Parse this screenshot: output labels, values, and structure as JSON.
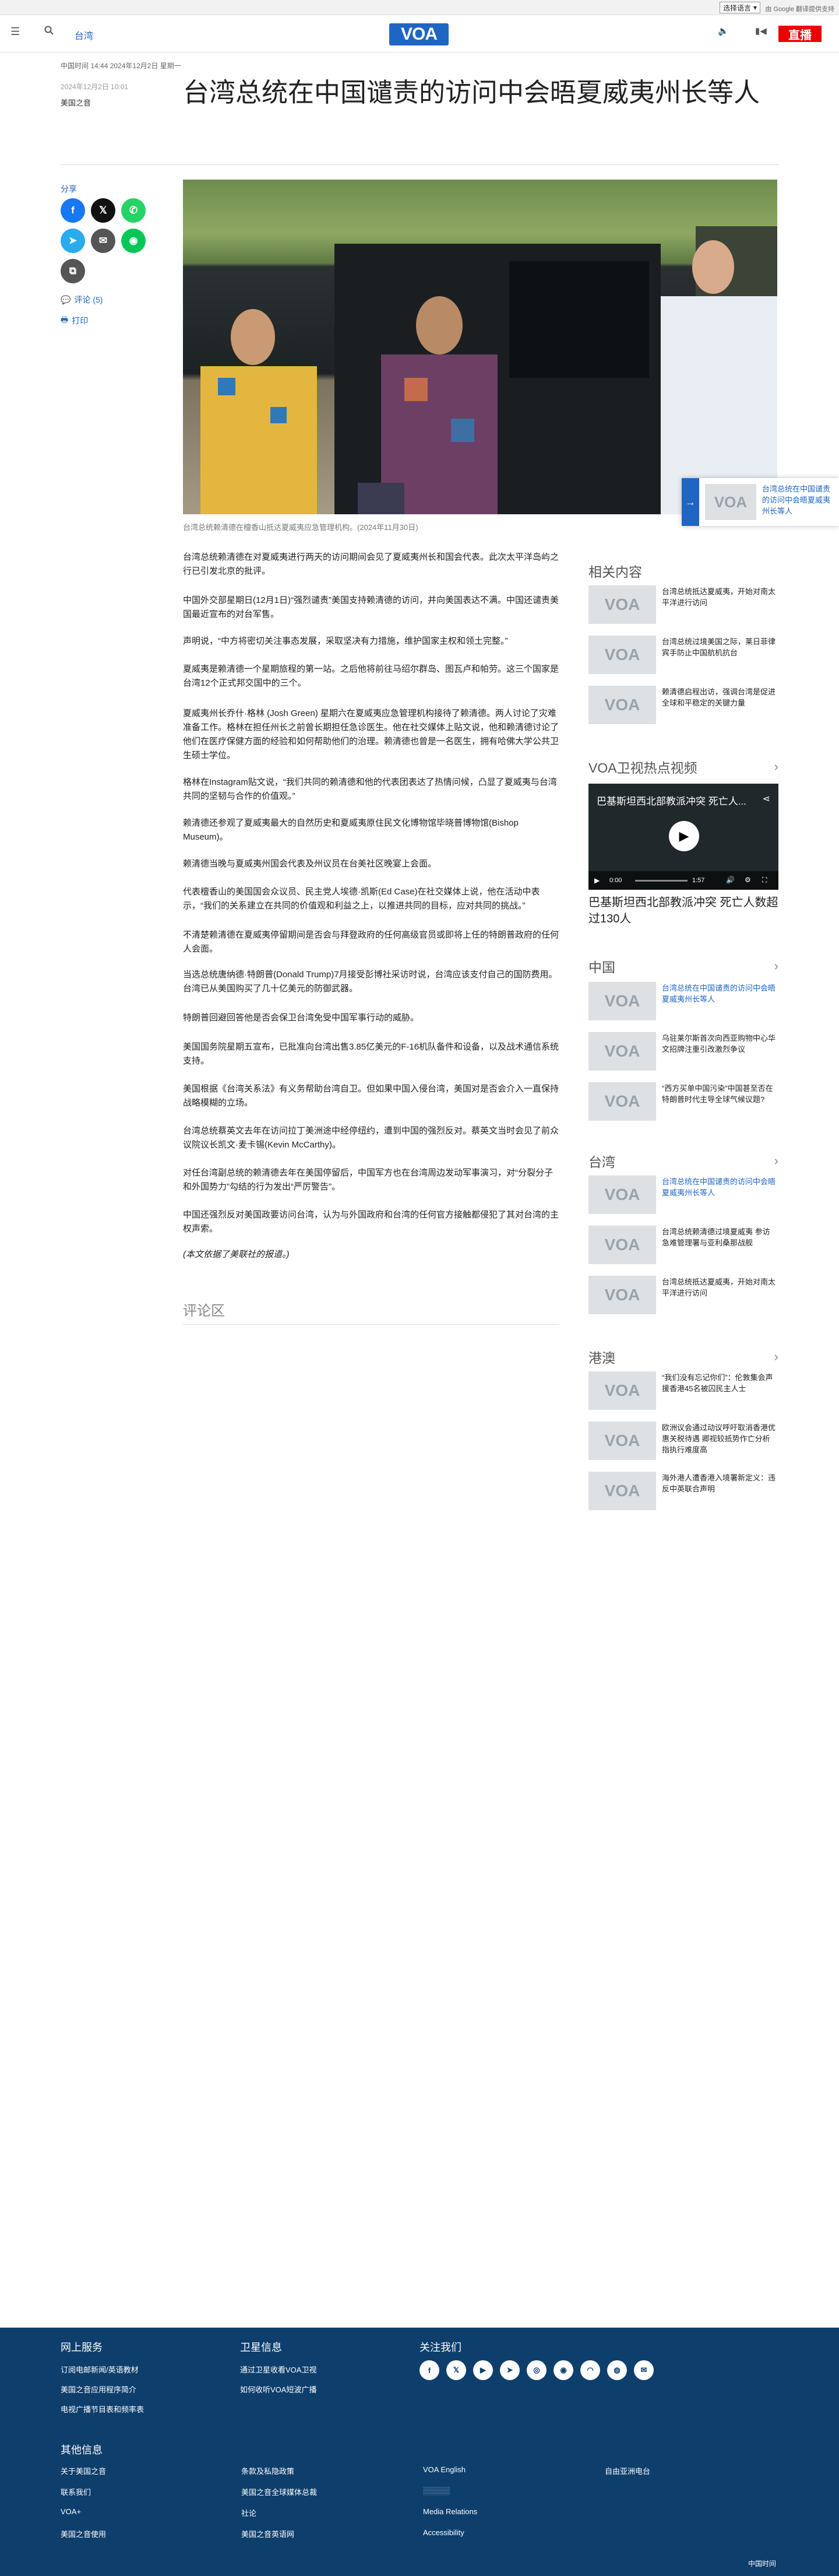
{
  "topbar": {
    "language_select": "选择语言",
    "translate_credit": "由 Google 翻译提供支持"
  },
  "header": {
    "section": "台湾",
    "logo": "VOA",
    "live": "直播",
    "menu_icon": "menu-icon",
    "search_icon": "search-icon"
  },
  "article": {
    "datetime": "中国时间 14:44 2024年12月2日 星期一",
    "published": "2024年12月2日 10:01",
    "author": "美国之音",
    "title": "台湾总统在中国谴责的访问中会晤夏威夷州长等人",
    "share_label": "分享",
    "comments_link": "评论 (5)",
    "print_link": "打印",
    "caption": "台湾总统赖清德在檀香山抵达夏威夷应急管理机构。(2024年11月30日)",
    "paragraphs": [
      "台湾总统赖清德在对夏威夷进行两天的访问期间会见了夏威夷州长和国会代表。此次太平洋岛屿之行已引发北京的批评。",
      "中国外交部星期日(12月1日)“强烈谴责”美国支持赖清德的访问，并向美国表达不满。中国还谴责美国最近宣布的对台军售。",
      "声明说，“中方将密切关注事态发展，采取坚决有力措施，维护国家主权和领土完整。”",
      "夏威夷是赖清德一个星期旅程的第一站。之后他将前往马绍尔群岛、图瓦卢和帕劳。这三个国家是台湾12个正式邦交国中的三个。",
      "夏威夷州长乔什·格林 (Josh Green) 星期六在夏威夷应急管理机构接待了赖清德。两人讨论了灾难准备工作。格林在担任州长之前曾长期担任急诊医生。他在社交媒体上贴文说，他和赖清德讨论了他们在医疗保健方面的经验和如何帮助他们的治理。赖清德也曾是一名医生，拥有哈佛大学公共卫生硕士学位。",
      "格林在Instagram贴文说，“我们共同的赖清德和他的代表团表达了热情问候，凸显了夏威夷与台湾共同的坚韧与合作的价值观。”",
      "赖清德还参观了夏威夷最大的自然历史和夏威夷原住民文化博物馆毕晓普博物馆(Bishop Museum)。",
      "赖清德当晚与夏威夷州国会代表及州议员在台美社区晚宴上会面。",
      "代表檀香山的美国国会众议员、民主党人埃德·凯斯(Ed Case)在社交媒体上说，他在活动中表示，“我们的关系建立在共同的价值观和利益之上，以推进共同的目标，应对共同的挑战。”",
      "不清楚赖清德在夏威夷停留期间是否会与拜登政府的任何高级官员或即将上任的特朗普政府的任何人会面。",
      "当选总统唐纳德·特朗普(Donald Trump)7月接受彭博社采访时说，台湾应该支付自己的国防费用。台湾已从美国购买了几十亿美元的防御武器。",
      "特朗普回避回答他是否会保卫台湾免受中国军事行动的威胁。",
      "美国国务院星期五宣布，已批准向台湾出售3.85亿美元的F-16机队备件和设备，以及战术通信系统支持。",
      "美国根据《台湾关系法》有义务帮助台湾自卫。但如果中国入侵台湾，美国对是否会介入一直保持战略模糊的立场。",
      "台湾总统蔡英文去年在访问拉丁美洲途中经停纽约，遭到中国的强烈反对。蔡英文当时会见了前众议院议长凯文·麦卡锡(Kevin McCarthy)。",
      "对任台湾副总统的赖清德去年在美国停留后，中国军方也在台湾周边发动军事演习，对“分裂分子和外国势力”勾结的行为发出“严厉警告”。",
      "中国还强烈反对美国政要访问台湾，认为与外国政府和台湾的任何官方接触都侵犯了其对台湾的主权声索。",
      "(本文依据了美联社的报道。)"
    ],
    "comments_heading": "评论区"
  },
  "sidebar": {
    "related": {
      "heading": "相关内容",
      "items": [
        "台湾总统抵达夏威夷，开始对南太平洋进行访问",
        "台湾总统过境美国之际，莱日菲律宾手防止中国航机抗台",
        "赖清德启程出访，强调台湾是促进全球和平稳定的关键力量"
      ]
    },
    "video": {
      "heading": "VOA卫视热点视频",
      "title": "巴基斯坦西北部教派冲突 死亡人...",
      "time_current": "0:00",
      "time_total": "1:57",
      "caption": "巴基斯坦西北部教派冲突 死亡人数超过130人"
    },
    "china": {
      "heading": "中国",
      "items": [
        "台湾总统在中国谴责的访问中会晤夏威夷州长等人",
        "乌驻莱尔斯首次向西亚购物中心华文招牌注重引改激烈争议",
        "“西方买单中国污染”中国甚至否在特朗普时代主导全球气候议题?"
      ]
    },
    "taiwan": {
      "heading": "台湾",
      "items": [
        "台湾总统在中国谴责的访问中会晤夏威夷州长等人",
        "台湾总统赖清德过境夏威夷 参访急难管理署与亚利桑那战舰",
        "台湾总统抵达夏威夷，开始对南太平洋进行访问"
      ]
    },
    "hongkong": {
      "heading": "港澳",
      "items": [
        "“我们没有忘记你们”：伦敦集会声援香港45名被囚民主人士",
        "欧洲议会通过动议呼吁取消香港优惠关税待遇 卿视较抵势作亡分析指执行难度高",
        "海外港人遭香港入境署新定义：违反中英联合声明"
      ]
    }
  },
  "sticky": {
    "text": "台湾总统在中国谴责的访问中会晤夏威夷州长等人"
  },
  "footer": {
    "online_heading": "网上服务",
    "online_links": [
      "订阅电邮新闻/英语教材",
      "美国之音应用程序简介",
      "电视广播节目表和频率表"
    ],
    "satellite_heading": "卫星信息",
    "satellite_links": [
      "通过卫星收看VOA卫视",
      "如何收听VOA短波广播"
    ],
    "follow_heading": "关注我们",
    "social_icons": [
      "facebook-icon",
      "x-icon",
      "youtube-icon",
      "telegram-icon",
      "instagram-icon",
      "podcast-icon",
      "rss-icon",
      "podcast-alt-icon",
      "email-icon"
    ],
    "other_heading": "其他信息",
    "other_links": [
      "关于美国之音",
      "联系我们",
      "VOA+",
      "美国之音使用",
      "条款及私隐政策",
      "美国之音全球媒体总裁",
      "社论",
      "美国之音英语网",
      "VOA English",
      "Media Relations",
      "Accessibility",
      "自由亚洲电台"
    ],
    "copyright": "中国时间"
  }
}
